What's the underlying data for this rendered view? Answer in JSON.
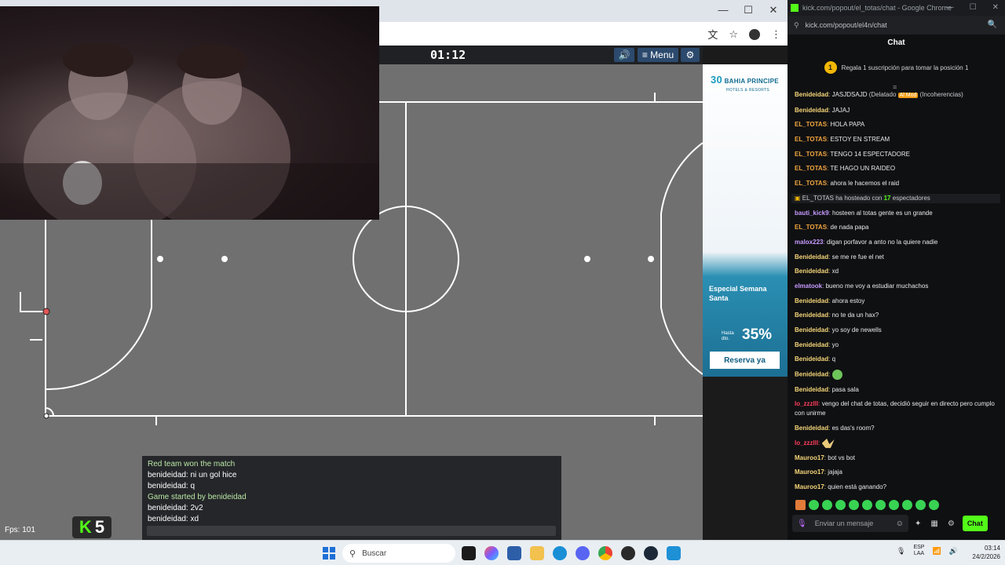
{
  "left_browser": {
    "window_controls": [
      "—",
      "☐",
      "✕"
    ]
  },
  "game": {
    "timer": "01:12",
    "menu_label": "Menu",
    "fps_label": "Fps: 101",
    "badge_k": "K",
    "badge_number": "5",
    "chat_lines": [
      {
        "text": "Red team won the match",
        "system": true
      },
      {
        "text": "benideidad: ni un gol hice",
        "system": false
      },
      {
        "text": "benideidad: q",
        "system": false
      },
      {
        "text": "Game started by benideidad",
        "system": true
      },
      {
        "text": "benideidad: 2v2",
        "system": false
      },
      {
        "text": "benideidad: xd",
        "system": false
      }
    ]
  },
  "ad": {
    "logo_num": "30",
    "logo_name": "BAHIA PRINCIPE",
    "logo_sub": "HOTELS & RESORTS",
    "title": "Especial Semana Santa",
    "hasta_line1": "Hasta",
    "hasta_line2": "dto.",
    "percent": "35%",
    "cta": "Reserva ya"
  },
  "chat_window": {
    "window_title": "kick.com/popout/el_totas/chat - Google Chrome",
    "url": "kick.com/popout/el4n/chat",
    "header": "Chat",
    "sub_banner_num": "1",
    "sub_banner_text": "Regala 1 suscripción para tomar la posición 1",
    "input_placeholder": "Enviar un mensaje",
    "send_label": "Chat",
    "messages": [
      {
        "user": "Benideidad",
        "color": "y",
        "text": "JASJDSAJD",
        "extra_paren": "(Delatado",
        "mod": "Al Mod",
        "tail": "(Incoherencias)"
      },
      {
        "user": "Benideidad",
        "color": "y",
        "text": "JAJAJ"
      },
      {
        "user": "EL_TOTAS",
        "color": "o",
        "text": "HOLA PAPA"
      },
      {
        "user": "EL_TOTAS",
        "color": "o",
        "text": "ESTOY EN STREAM"
      },
      {
        "user": "EL_TOTAS",
        "color": "o",
        "text": "TENGO 14 ESPECTADORE"
      },
      {
        "user": "EL_TOTAS",
        "color": "o",
        "text": "TE HAGO UN RAIDEO"
      },
      {
        "user": "EL_TOTAS",
        "color": "o",
        "text": "ahora le hacemos el raid"
      },
      {
        "host": true,
        "host_user": "EL_TOTAS",
        "host_mid": "ha hosteado con",
        "host_num": "17",
        "host_tail": "espectadores"
      },
      {
        "user": "bauti_kick9",
        "color": "p",
        "text": "hosteen al totas gente es un grande"
      },
      {
        "user": "EL_TOTAS",
        "color": "o",
        "text": "de nada papa"
      },
      {
        "user": "malox223",
        "color": "p",
        "text": "digan porfavor a anto no la quiere nadie"
      },
      {
        "user": "Benideidad",
        "color": "y",
        "text": "se me re fue el net"
      },
      {
        "user": "Benideidad",
        "color": "y",
        "text": "xd"
      },
      {
        "user": "elmatook",
        "color": "p",
        "text": "bueno me voy a estudiar muchachos"
      },
      {
        "user": "Benideidad",
        "color": "y",
        "text": "ahora estoy"
      },
      {
        "user": "Benideidad",
        "color": "y",
        "text": "no te da un hax?"
      },
      {
        "user": "Benideidad",
        "color": "y",
        "text": "yo soy de newells"
      },
      {
        "user": "Benideidad",
        "color": "y",
        "text": "yo"
      },
      {
        "user": "Benideidad",
        "color": "y",
        "text": "q"
      },
      {
        "user": "Benideidad",
        "color": "y",
        "text": "",
        "emote": true
      },
      {
        "user": "Benideidad",
        "color": "y",
        "text": "pasa sala"
      },
      {
        "user": "lo_zzzlll",
        "color": "r",
        "text": "vengo del chat de totas, decidió seguir en directo pero cumplo con unirme"
      },
      {
        "user": "Benideidad",
        "color": "y",
        "text": "es das's room?"
      },
      {
        "user": "lo_zzzlll",
        "color": "r",
        "text": "",
        "wing": true
      },
      {
        "user": "Mauroo17",
        "color": "w",
        "text": "bot vs bot"
      },
      {
        "user": "Mauroo17",
        "color": "w",
        "text": "jajaja"
      },
      {
        "user": "Mauroo17",
        "color": "w",
        "text": "quien está ganando?"
      }
    ]
  },
  "taskbar": {
    "search_placeholder": "Buscar",
    "lang_line1": "ESP",
    "lang_line2": "LAA",
    "time": "03:14",
    "date": "24/2/2026"
  },
  "colors": {
    "kick_green": "#53fc18",
    "pitch": "#6f6f6f",
    "game_bar": "#1f2124"
  }
}
